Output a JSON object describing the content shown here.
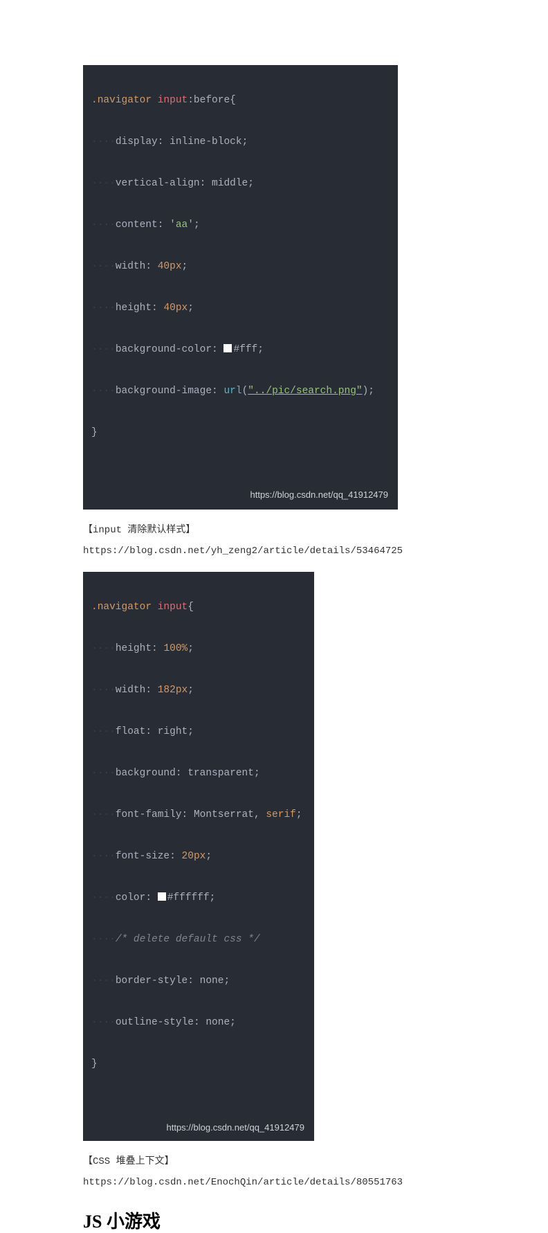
{
  "code1": {
    "selector_class": ".navigator",
    "selector_tag": "input",
    "selector_pseudo": ":before",
    "open": "{",
    "close": "}",
    "lines": [
      {
        "prop": "display",
        "val_plain": "inline-block"
      },
      {
        "prop": "vertical-align",
        "val_plain": "middle"
      },
      {
        "prop": "content",
        "val_string": "'aa'"
      },
      {
        "prop": "width",
        "val_num": "40px"
      },
      {
        "prop": "height",
        "val_num": "40px"
      },
      {
        "prop": "background-color",
        "val_swatch": true,
        "val_hex": "#fff"
      },
      {
        "prop": "background-image",
        "val_func": "url",
        "val_url": "\"../pic/search.png\""
      }
    ],
    "watermark": "https://blog.csdn.net/qq_41912479"
  },
  "para1_label": "【input 清除默认样式】",
  "link1": "https://blog.csdn.net/yh_zeng2/article/details/53464725",
  "code2": {
    "selector_class": ".navigator",
    "selector_tag": "input",
    "open": "{",
    "close": "}",
    "lines": [
      {
        "prop": "height",
        "val_num": "100%"
      },
      {
        "prop": "width",
        "val_num": "182px"
      },
      {
        "prop": "float",
        "val_plain": "right"
      },
      {
        "prop": "background",
        "val_plain": "transparent"
      },
      {
        "prop": "font-family",
        "val_fontlist": "Montserrat, ",
        "val_font2": "serif"
      },
      {
        "prop": "font-size",
        "val_num": "20px"
      },
      {
        "prop": "color",
        "val_swatch": true,
        "val_hex": "#ffffff"
      },
      {
        "comment": "/* delete default css */"
      },
      {
        "prop": "border-style",
        "val_plain": "none"
      },
      {
        "prop": "outline-style",
        "val_plain": "none"
      }
    ],
    "watermark": "https://blog.csdn.net/qq_41912479"
  },
  "para2_label": "【CSS 堆叠上下文】",
  "link2": "https://blog.csdn.net/EnochQin/article/details/80551763",
  "heading": "JS 小游戏"
}
